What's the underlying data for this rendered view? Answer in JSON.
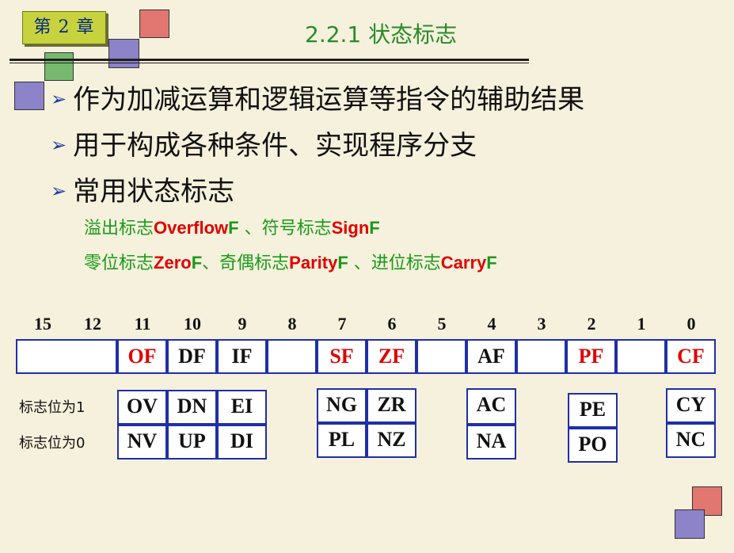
{
  "header": {
    "chapter": "第 2 章",
    "title": "2.2.1  状态标志"
  },
  "bullets": [
    "作为加减运算和逻辑运算等指令的辅助结果",
    "用于构成各种条件、实现程序分支",
    "常用状态标志"
  ],
  "sub_lines": {
    "line1": {
      "a": "溢出标志",
      "b": "Overflow",
      "c": "F",
      "d": " 、符号标志",
      "e": "Sign",
      "f": "F"
    },
    "line2": {
      "a": "零位标志",
      "b": "Zero",
      "c": "F",
      "d": "、奇偶标志",
      "e": "Parity",
      "f": "F",
      "g": " 、进位标志",
      "h": "Carry",
      "i": "F"
    }
  },
  "bit_numbers": [
    "15",
    "12",
    "11",
    "10",
    "9",
    "8",
    "7",
    "6",
    "5",
    "4",
    "3",
    "2",
    "1",
    "0"
  ],
  "register_cells": [
    "",
    "OF",
    "DF",
    "IF",
    "",
    "SF",
    "ZF",
    "",
    "AF",
    "",
    "PF",
    "",
    "CF"
  ],
  "row_labels": {
    "one": "标志位为1",
    "zero": "标志位为0"
  },
  "flag1": {
    "of": "OV",
    "df": "DN",
    "if": "EI",
    "sf": "NG",
    "zf": "ZR",
    "af": "AC",
    "pf": "PE",
    "cf": "CY"
  },
  "flag0": {
    "of": "NV",
    "df": "UP",
    "if": "DI",
    "sf": "PL",
    "zf": "NZ",
    "af": "NA",
    "pf": "PO",
    "cf": "NC"
  },
  "colors": {
    "background": "#f5f1dc",
    "title": "#2a8a2a",
    "green_text": "#1a9a1a",
    "red_text": "#e00000",
    "border_blue": "#1f2fa8"
  }
}
